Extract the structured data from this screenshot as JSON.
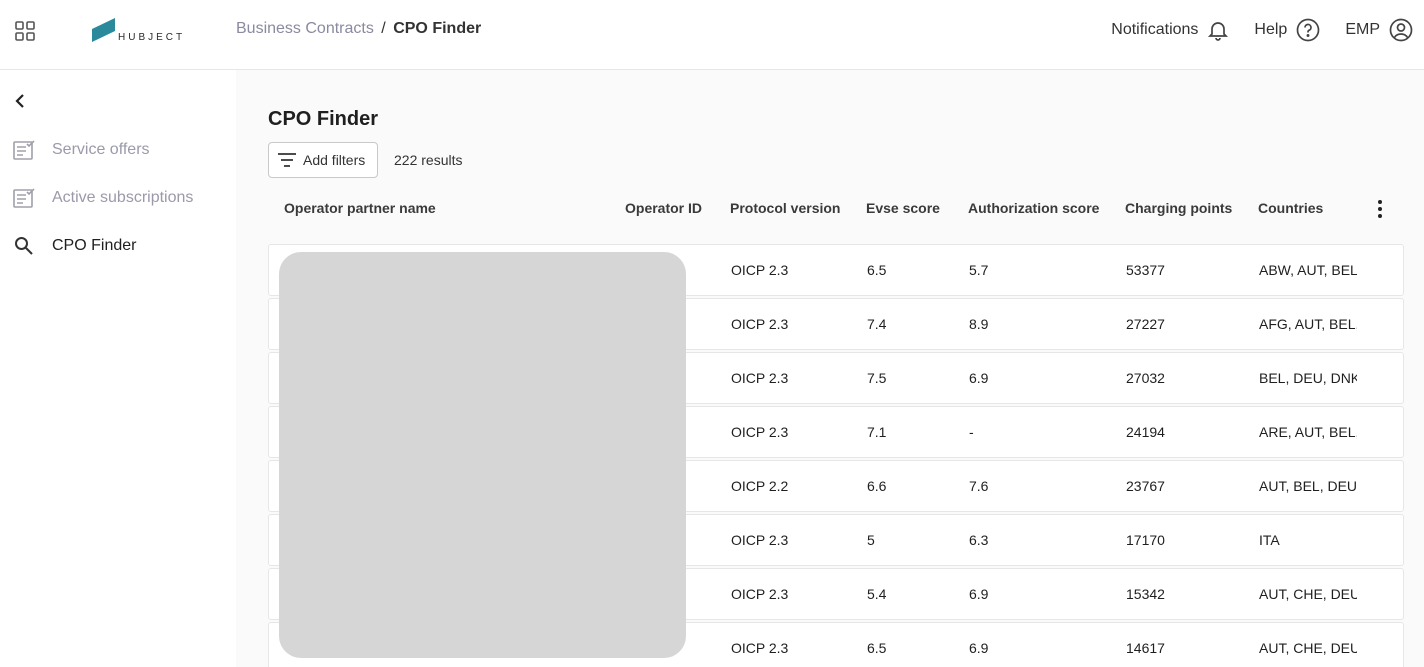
{
  "header": {
    "breadcrumb_parent": "Business Contracts",
    "breadcrumb_separator": "/",
    "breadcrumb_current": "CPO Finder",
    "notifications_label": "Notifications",
    "help_label": "Help",
    "account_label": "EMP",
    "logo_text": "HUBJECT",
    "logo_color": "#2a8a9c"
  },
  "sidebar": {
    "items": [
      {
        "label": "Service offers",
        "icon": "document-check-icon"
      },
      {
        "label": "Active subscriptions",
        "icon": "document-check-icon"
      },
      {
        "label": "CPO Finder",
        "icon": "search-icon"
      }
    ]
  },
  "page": {
    "title": "CPO Finder",
    "filter_button": "Add filters",
    "results_text": "222 results"
  },
  "table": {
    "columns": [
      "Operator partner name",
      "Operator ID",
      "Protocol version",
      "Evse score",
      "Authorization score",
      "Charging points",
      "Countries"
    ],
    "rows": [
      {
        "protocol": "OICP 2.3",
        "evse": "6.5",
        "auth": "5.7",
        "points": "53377",
        "countries": "ABW, AUT, BEL,"
      },
      {
        "protocol": "OICP 2.3",
        "evse": "7.4",
        "auth": "8.9",
        "points": "27227",
        "countries": "AFG, AUT, BEL, C"
      },
      {
        "protocol": "OICP 2.3",
        "evse": "7.5",
        "auth": "6.9",
        "points": "27032",
        "countries": "BEL, DEU, DNK,"
      },
      {
        "protocol": "OICP 2.3",
        "evse": "7.1",
        "auth": "-",
        "points": "24194",
        "countries": "ARE, AUT, BEL, C"
      },
      {
        "protocol": "OICP 2.2",
        "evse": "6.6",
        "auth": "7.6",
        "points": "23767",
        "countries": "AUT, BEL, DEU, F"
      },
      {
        "protocol": "OICP 2.3",
        "evse": "5",
        "auth": "6.3",
        "points": "17170",
        "countries": "ITA"
      },
      {
        "protocol": "OICP 2.3",
        "evse": "5.4",
        "auth": "6.9",
        "points": "15342",
        "countries": "AUT, CHE, DEU,"
      },
      {
        "protocol": "OICP 2.3",
        "evse": "6.5",
        "auth": "6.9",
        "points": "14617",
        "countries": "AUT, CHE, DEU,"
      }
    ]
  }
}
